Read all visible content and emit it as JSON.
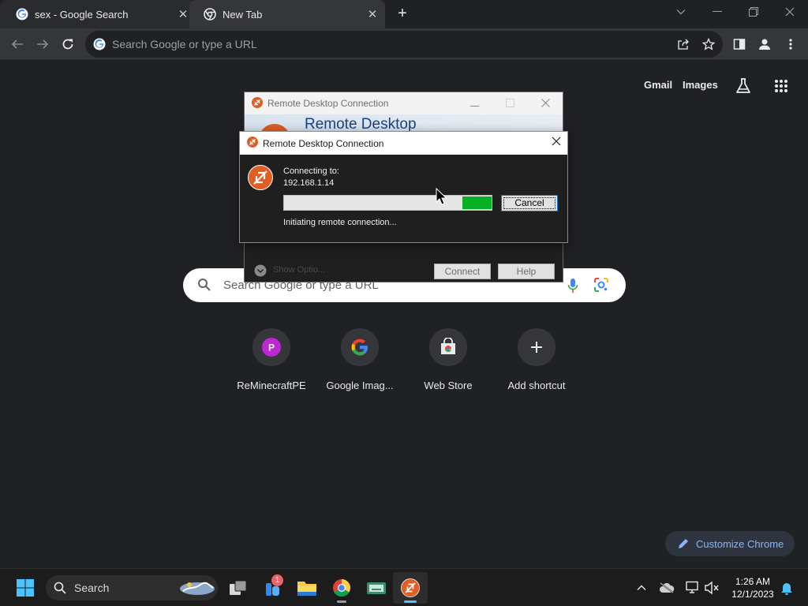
{
  "browser": {
    "tabs": [
      {
        "title": "sex - Google Search",
        "favicon": "google-g-icon"
      },
      {
        "title": "New Tab",
        "favicon": "chrome-icon"
      }
    ],
    "omnibox_placeholder": "Search Google or type a URL"
  },
  "ntp": {
    "links": {
      "gmail": "Gmail",
      "images": "Images"
    },
    "search_placeholder": "Search Google or type a URL",
    "shortcuts": [
      {
        "label": "ReMinecraftPE",
        "initial": "P",
        "color": "#c026d3"
      },
      {
        "label": "Google Imag...",
        "icon": "google-g-icon"
      },
      {
        "label": "Web Store",
        "icon": "web-store-icon"
      },
      {
        "label": "Add shortcut",
        "icon": "plus-icon"
      }
    ],
    "customize_label": "Customize Chrome"
  },
  "rdc_back": {
    "title": "Remote Desktop Connection",
    "banner": "Remote Desktop",
    "show_options": "Show Optio...",
    "connect": "Connect",
    "help": "Help"
  },
  "rdc_front": {
    "title": "Remote Desktop Connection",
    "connecting_to": "Connecting to:",
    "address": "192.168.1.14",
    "status": "Initiating remote connection...",
    "cancel": "Cancel"
  },
  "taskbar": {
    "search_label": "Search",
    "notification_badge": "1",
    "time": "1:26 AM",
    "date": "12/1/2023"
  }
}
